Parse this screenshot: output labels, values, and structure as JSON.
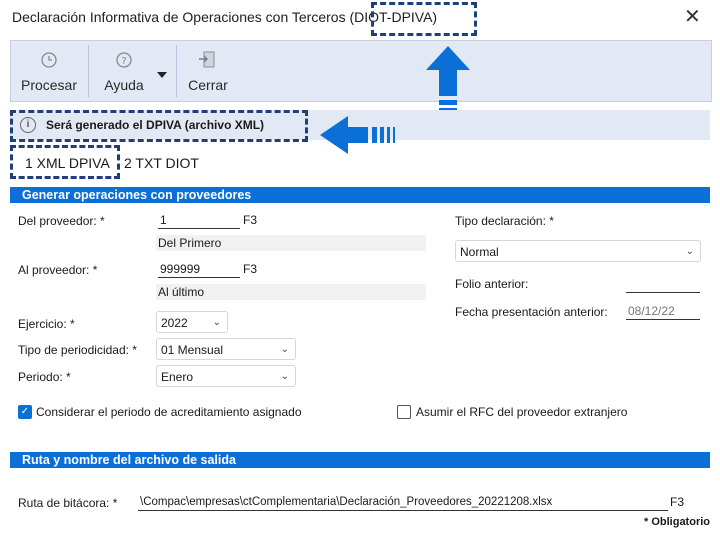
{
  "window": {
    "title": "Declaración Informativa de Operaciones con Terceros (DIOT-DPIVA)",
    "close_glyph": "✕"
  },
  "toolbar": {
    "items": [
      {
        "label": "Procesar",
        "icon": "clock-icon"
      },
      {
        "label": "Ayuda",
        "icon": "help-icon"
      },
      {
        "label": "Cerrar",
        "icon": "exit-door-icon"
      }
    ]
  },
  "info": {
    "icon_glyph": "i",
    "text": "Será generado el DPIVA (archivo XML)"
  },
  "tabs": [
    {
      "label": "1 XML DPIVA",
      "active": true
    },
    {
      "label": "2 TXT DIOT",
      "active": false
    }
  ],
  "section1": {
    "title": "Generar operaciones con proveedores",
    "del_proveedor": {
      "label": "Del proveedor: *",
      "value": "1",
      "f3": "F3",
      "desc": "Del Primero"
    },
    "al_proveedor": {
      "label": "Al proveedor: *",
      "value": "999999",
      "f3": "F3",
      "desc": "Al último"
    },
    "ejercicio": {
      "label": "Ejercicio: *",
      "value": "2022"
    },
    "tipo_periodicidad": {
      "label": "Tipo de periodicidad: *",
      "value": "01 Mensual"
    },
    "periodo": {
      "label": "Periodo: *",
      "value": "Enero"
    },
    "tipo_declaracion": {
      "label": "Tipo declaración: *",
      "value": "Normal"
    },
    "folio_anterior": {
      "label": "Folio anterior:",
      "value": ""
    },
    "fecha_presentacion": {
      "label": "Fecha presentación anterior:",
      "value": "08/12/22"
    },
    "chk_acreditamiento": {
      "label": "Considerar el periodo de acreditamiento asignado",
      "checked": true
    },
    "chk_rfc": {
      "label": "Asumir el RFC del proveedor extranjero",
      "checked": false
    }
  },
  "section2": {
    "title": "Ruta y nombre del archivo de salida",
    "ruta": {
      "label": "Ruta de bitácora: *",
      "value": "\\Compac\\empresas\\ctComplementaria\\Declaración_Proveedores_20221208.xlsx",
      "f3": "F3"
    }
  },
  "footer": {
    "required_note": "* Obligatorio"
  },
  "colors": {
    "accent": "#0b6fd8",
    "toolbar_bg": "#e3e8f5",
    "annotation": "#1e3f7a"
  }
}
